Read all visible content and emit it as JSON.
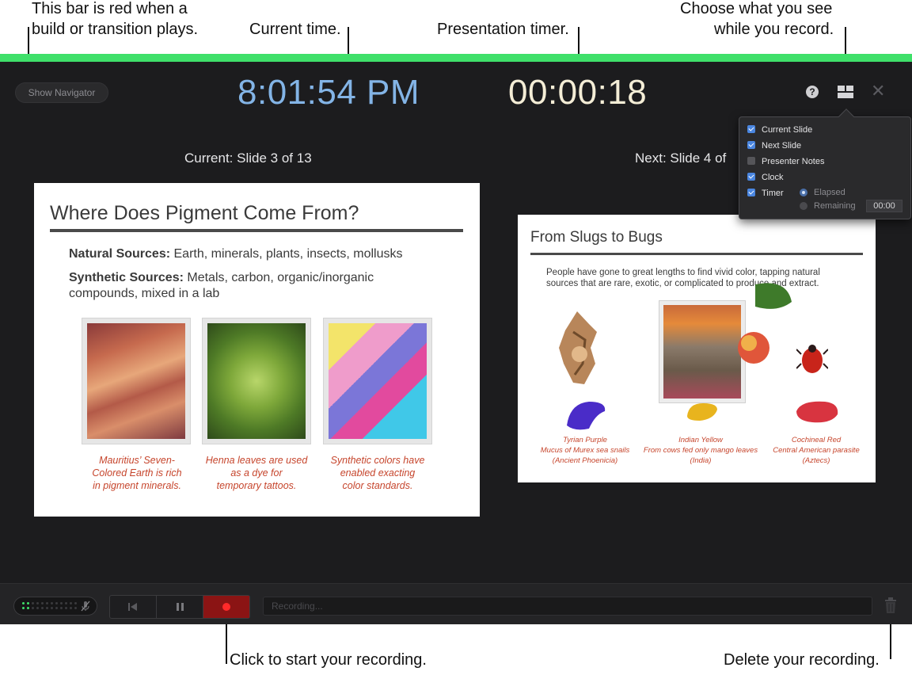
{
  "annotations": {
    "bar_red_line1": "This bar is red when a",
    "bar_red_line2": "build or transition plays.",
    "current_time": "Current time.",
    "presentation_timer": "Presentation timer.",
    "choose_line1": "Choose what you see",
    "choose_line2": "while you record.",
    "start_recording": "Click to start your recording.",
    "delete_recording": "Delete your recording."
  },
  "colors": {
    "status_bar": "#3fe06a",
    "clock": "#83b4e6",
    "timer": "#f4edd6",
    "record_button": "#8b1414",
    "caption_red": "#c6452c"
  },
  "toolbar": {
    "show_navigator": "Show Navigator",
    "clock": "8:01:54 PM",
    "timer": "00:00:18",
    "help_label": "?",
    "help_icon": "help-icon",
    "layout_icon": "layout-icon",
    "close_label": "✕",
    "close_icon": "close-icon"
  },
  "current": {
    "label": "Current: Slide 3 of 13",
    "slide": {
      "title": "Where Does Pigment Come From?",
      "natural_label": "Natural Sources:",
      "natural_text": " Earth, minerals, plants, insects, mollusks",
      "synthetic_label": "Synthetic Sources:",
      "synthetic_text_1": " Metals, carbon, organic/inorganic",
      "synthetic_text_2": "compounds, mixed in a lab",
      "captions": [
        {
          "l1": "Mauritius’ Seven-",
          "l2": "Colored Earth is rich",
          "l3": "in pigment minerals."
        },
        {
          "l1": "Henna leaves are used",
          "l2": "as a dye for",
          "l3": "temporary tattoos."
        },
        {
          "l1": "Synthetic colors have",
          "l2": "enabled exacting",
          "l3": "color standards."
        }
      ]
    }
  },
  "next": {
    "label": "Next: Slide 4 of",
    "slide": {
      "title": "From Slugs to Bugs",
      "body_1": "People have gone to great lengths to find vivid color, tapping natural",
      "body_2": "sources that are rare, exotic, or complicated to produce and extract.",
      "captions": [
        {
          "l1": "Tyrian Purple",
          "l2": "Mucus of Murex sea snails",
          "l3": "(Ancient Phoenicia)"
        },
        {
          "l1": "Indian Yellow",
          "l2": "From cows fed only mango leaves",
          "l3": "(India)"
        },
        {
          "l1": "Cochineal Red",
          "l2": "Central American parasite",
          "l3": "(Aztecs)"
        }
      ]
    }
  },
  "options": {
    "current_slide": "Current Slide",
    "next_slide": "Next Slide",
    "presenter_notes": "Presenter Notes",
    "clock": "Clock",
    "timer": "Timer",
    "elapsed": "Elapsed",
    "remaining": "Remaining",
    "remaining_value": "00:00",
    "checked": {
      "current_slide": true,
      "next_slide": true,
      "presenter_notes": false,
      "clock": true,
      "timer": true
    },
    "timer_mode": "elapsed"
  },
  "recording": {
    "field_placeholder": "Recording...",
    "mic_icon": "microphone-muted-icon",
    "rewind_icon": "skip-to-start-icon",
    "pause_icon": "pause-icon",
    "record_icon": "record-icon",
    "trash_icon": "trash-icon"
  }
}
